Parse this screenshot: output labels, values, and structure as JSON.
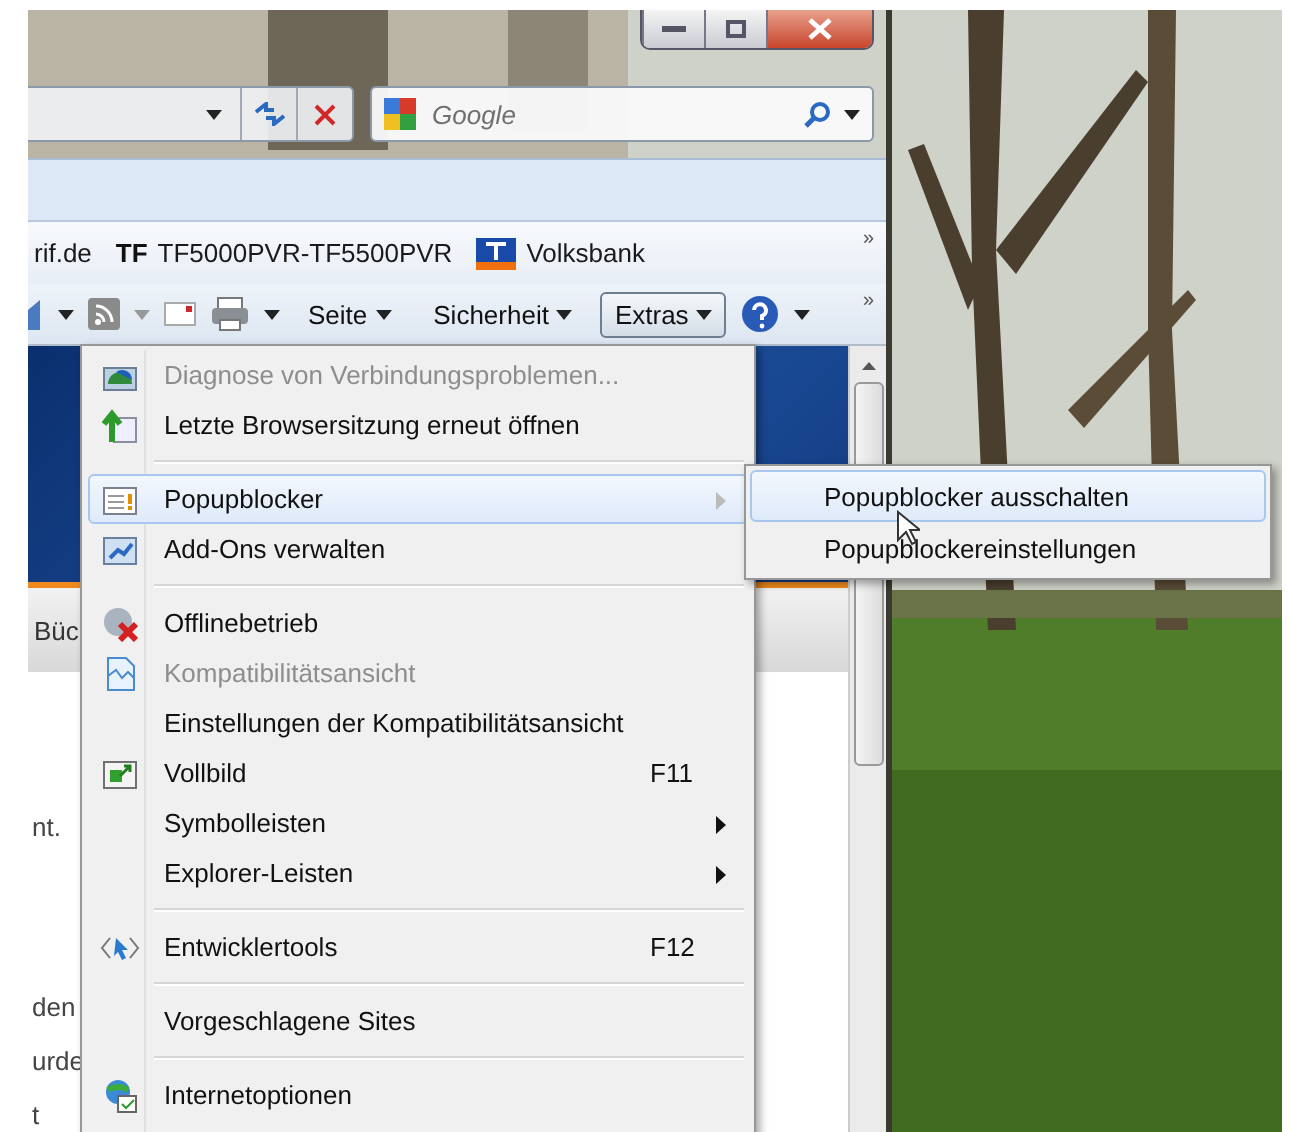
{
  "search": {
    "placeholder": "Google"
  },
  "favorites": [
    {
      "label": "rif.de"
    },
    {
      "label": "TF5000PVR-TF5500PVR",
      "badge": "TF"
    },
    {
      "label": "Volksbank"
    }
  ],
  "favorites_chevron": "»",
  "command_bar": [
    {
      "label": "Seite",
      "selected": false
    },
    {
      "label": "Sicherheit",
      "selected": false
    },
    {
      "label": "Extras",
      "selected": true
    }
  ],
  "command_chevron": "»",
  "page_fragments": [
    "Büc",
    "nt.",
    "den",
    "urde",
    "t"
  ],
  "menu": [
    {
      "kind": "item",
      "label": "Diagnose von Verbindungsproblemen...",
      "disabled": true,
      "selected": false,
      "submenu": false
    },
    {
      "kind": "item",
      "label": "Letzte Browsersitzung erneut öffnen",
      "disabled": false,
      "selected": false,
      "submenu": false
    },
    {
      "kind": "separator"
    },
    {
      "kind": "item",
      "label": "Popupblocker",
      "disabled": false,
      "selected": true,
      "submenu": true
    },
    {
      "kind": "item",
      "label": "Add-Ons verwalten",
      "disabled": false,
      "selected": false,
      "submenu": false
    },
    {
      "kind": "separator"
    },
    {
      "kind": "item",
      "label": "Offlinebetrieb",
      "disabled": false,
      "selected": false,
      "submenu": false
    },
    {
      "kind": "item",
      "label": "Kompatibilitätsansicht",
      "disabled": true,
      "selected": false,
      "submenu": false
    },
    {
      "kind": "item",
      "label": "Einstellungen der Kompatibilitätsansicht",
      "disabled": false,
      "selected": false,
      "submenu": false
    },
    {
      "kind": "item",
      "label": "Vollbild",
      "shortcut": "F11",
      "disabled": false,
      "selected": false,
      "submenu": false
    },
    {
      "kind": "item",
      "label": "Symbolleisten",
      "disabled": false,
      "selected": false,
      "submenu": true
    },
    {
      "kind": "item",
      "label": "Explorer-Leisten",
      "disabled": false,
      "selected": false,
      "submenu": true
    },
    {
      "kind": "separator"
    },
    {
      "kind": "item",
      "label": "Entwicklertools",
      "shortcut": "F12",
      "disabled": false,
      "selected": false,
      "submenu": false
    },
    {
      "kind": "separator"
    },
    {
      "kind": "item",
      "label": "Vorgeschlagene Sites",
      "disabled": false,
      "selected": false,
      "submenu": false
    },
    {
      "kind": "separator"
    },
    {
      "kind": "item",
      "label": "Internetoptionen",
      "disabled": false,
      "selected": false,
      "submenu": false
    }
  ],
  "submenu": [
    {
      "label": "Popupblocker ausschalten",
      "selected": true
    },
    {
      "label": "Popupblockereinstellungen",
      "selected": false
    }
  ]
}
